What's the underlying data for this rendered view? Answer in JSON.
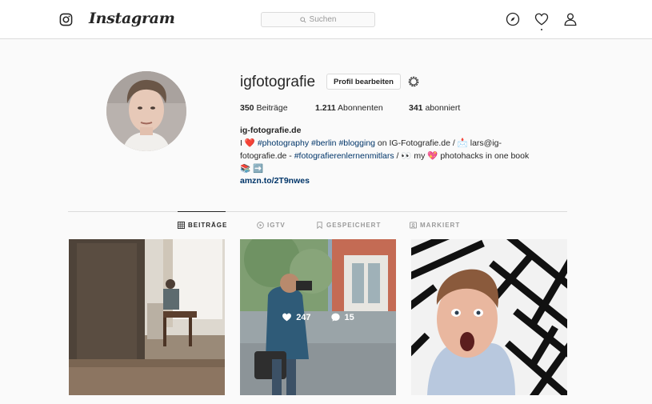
{
  "nav": {
    "wordmark": "Instagram",
    "search_placeholder": "Suchen"
  },
  "profile": {
    "username": "igfotografie",
    "edit_button": "Profil bearbeiten",
    "stats": {
      "posts_count": "350",
      "posts_label": "Beiträge",
      "followers_count": "1.211",
      "followers_label": "Abonnenten",
      "following_count": "341",
      "following_label": "abonniert"
    },
    "full_name": "ig-fotografie.de",
    "bio": {
      "line1_prefix": "I",
      "tag_photography": "#photography",
      "tag_berlin": "#berlin",
      "tag_blogging": "#blogging",
      "line1_suffix": "on IG-Fotografie.de /",
      "email_part1": "lars@ig-",
      "email_part2": "fotografie.de -",
      "tag_lernen": "#fotografierenlernenmitlars",
      "line2_mid": "/",
      "line2_my": "my",
      "line2_end": "photohacks in one book",
      "emoji_heart": "❤️",
      "emoji_mail": "📩",
      "emoji_eyes": "👀",
      "emoji_pink_heart": "💖",
      "emoji_books": "📚",
      "emoji_arrow": "➡️"
    },
    "link": "amzn.to/2T9nwes"
  },
  "tabs": [
    {
      "label": "BEITRÄGE",
      "active": true
    },
    {
      "label": "IGTV",
      "active": false
    },
    {
      "label": "GESPEICHERT",
      "active": false
    },
    {
      "label": "MARKIERT",
      "active": false
    }
  ],
  "posts": [
    {
      "alt": "room with person at window"
    },
    {
      "alt": "photographer on street",
      "likes": "247",
      "comments": "15"
    },
    {
      "alt": "selfie with striped wall"
    }
  ],
  "colors": {
    "link_blue": "#003569",
    "border": "#dbdbdb",
    "background": "#fafafa"
  },
  "icons": [
    "instagram-glyph-icon",
    "search-icon",
    "compass-icon",
    "heart-icon",
    "user-icon",
    "gear-icon",
    "grid-icon",
    "igtv-icon",
    "bookmark-icon",
    "tagged-icon",
    "comment-icon"
  ]
}
